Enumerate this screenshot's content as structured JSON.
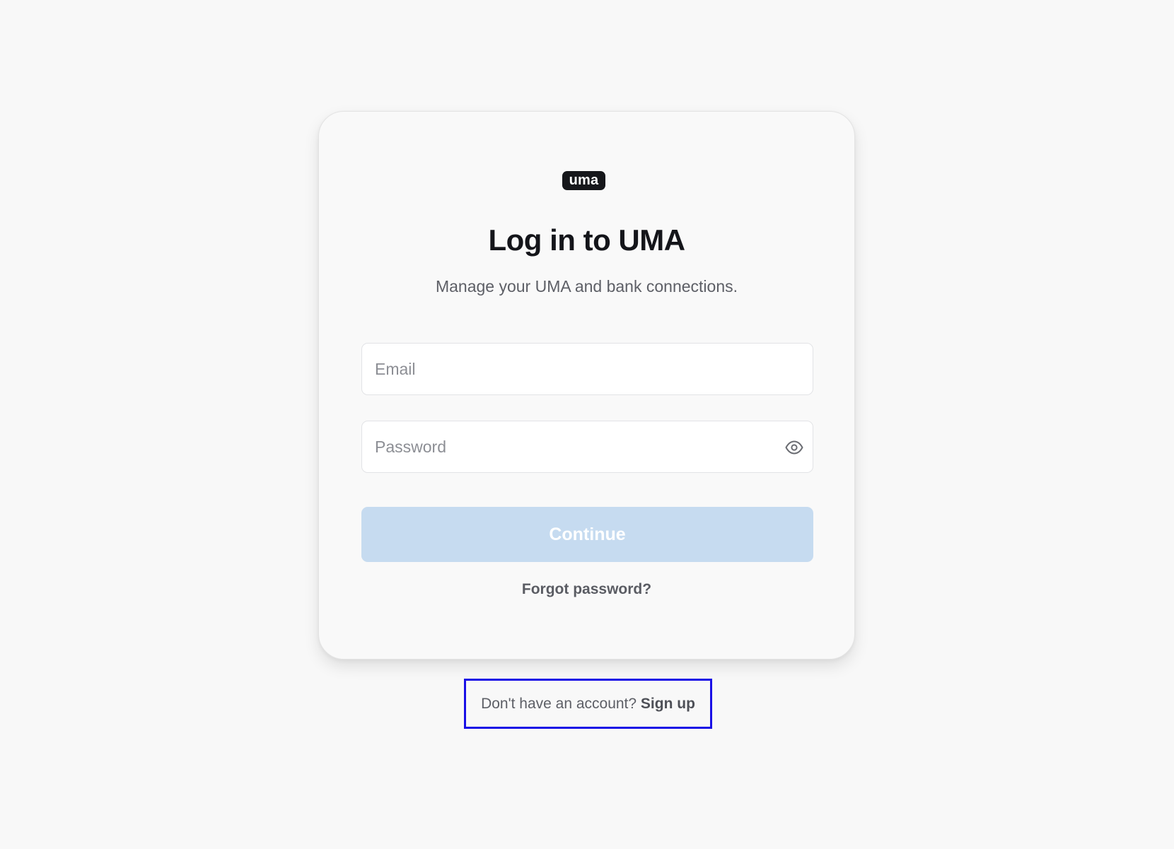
{
  "brand": {
    "logo_text": "uma"
  },
  "login": {
    "title": "Log in to UMA",
    "subtitle": "Manage your UMA and bank connections.",
    "email_placeholder": "Email",
    "email_value": "",
    "password_placeholder": "Password",
    "password_value": "",
    "password_toggle_icon": "eye-icon",
    "continue_label": "Continue",
    "forgot_label": "Forgot password?"
  },
  "signup": {
    "prompt": "Don't have an account?",
    "link_label": "Sign up"
  },
  "colors": {
    "background": "#f8f8f8",
    "card": "#f9f9f9",
    "logo_bg": "#16171b",
    "button_disabled": "#c6dbf0",
    "highlight_border": "#1a10e6"
  }
}
